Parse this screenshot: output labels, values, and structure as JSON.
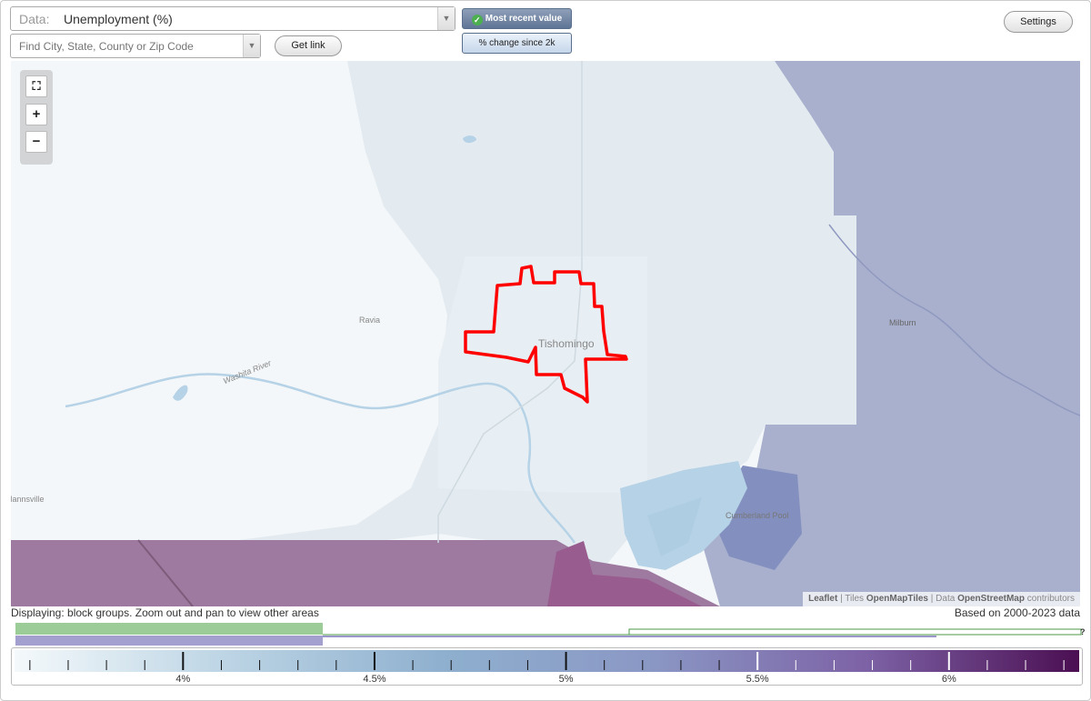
{
  "data_select": {
    "prefix": "Data:",
    "value": "Unemployment (%)"
  },
  "search": {
    "placeholder": "Find City, State, County or Zip Code"
  },
  "buttons": {
    "get_link": "Get link",
    "settings": "Settings"
  },
  "toggles": {
    "most_recent": "Most recent value",
    "change_since": "% change since 2k",
    "active": "most_recent"
  },
  "zoom": {
    "fullscreen": "⛶",
    "zoom_in": "+",
    "zoom_out": "−"
  },
  "map_labels": {
    "tishomingo": "Tishomingo",
    "ravia": "Ravia",
    "milburn": "Milburn",
    "mannsville": "Mannsville",
    "washita_river": "Washita River",
    "cumberland_pool": "Cumberland Pool"
  },
  "attribution": {
    "leaflet": "Leaflet",
    "sep1": " | Tiles ",
    "tiles": "OpenMapTiles",
    "sep2": " | Data ",
    "data": "OpenStreetMap",
    "contributors": " contributors"
  },
  "status": {
    "displaying": "Displaying: block groups. Zoom out and pan to view other areas",
    "based_on": "Based on 2000-2023 data"
  },
  "histogram_help": "?",
  "legend": {
    "ticks": [
      "4%",
      "4.5%",
      "5%",
      "5.5%",
      "6%"
    ],
    "tick_values": [
      4,
      4.5,
      5,
      5.5,
      6
    ],
    "min": 3.56,
    "max": 6.34,
    "colors": [
      "#f4f9fb",
      "#bcd4e4",
      "#8fb0cf",
      "#8a97c4",
      "#7d62a6",
      "#4b0f52"
    ]
  },
  "colors": {
    "highlight": "#ff0000",
    "purple_region": "#9e7aa0",
    "blue_region": "#a9b0cd",
    "river": "#b6d2e6"
  }
}
